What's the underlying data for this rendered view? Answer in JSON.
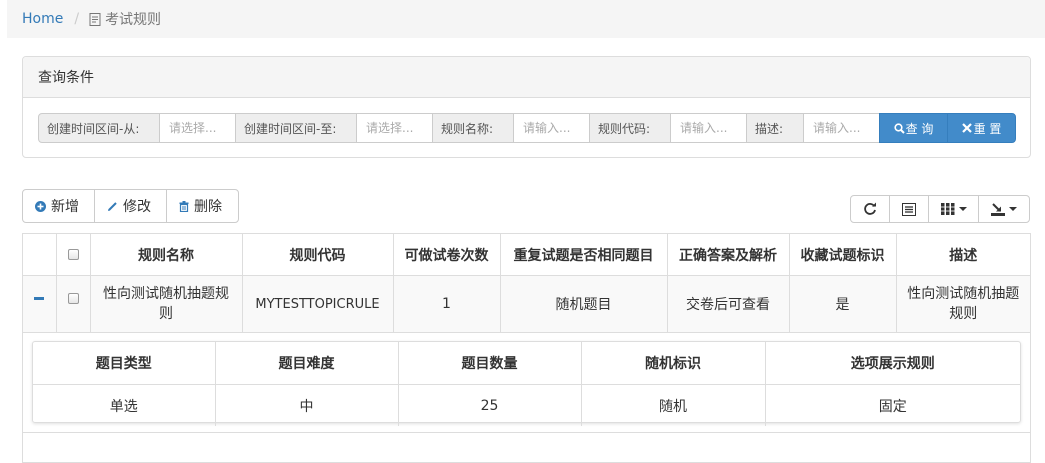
{
  "breadcrumb": {
    "home": "Home",
    "current": "考试规则"
  },
  "search": {
    "panel_title": "查询条件",
    "fields": [
      {
        "label": "创建时间区间-从:",
        "placeholder": "请选择..."
      },
      {
        "label": "创建时间区间-至:",
        "placeholder": "请选择..."
      },
      {
        "label": "规则名称:",
        "placeholder": "请输入..."
      },
      {
        "label": "规则代码:",
        "placeholder": "请输入..."
      },
      {
        "label": "描述:",
        "placeholder": "请输入..."
      }
    ],
    "query_label": "查 询",
    "reset_label": "重 置"
  },
  "toolbar": {
    "add": "新增",
    "edit": "修改",
    "delete": "删除"
  },
  "table": {
    "headers": [
      "规则名称",
      "规则代码",
      "可做试卷次数",
      "重复试题是否相同题目",
      "正确答案及解析",
      "收藏试题标识",
      "描述"
    ],
    "rows": [
      [
        "性向测试随机抽题规则",
        "MYTESTTOPICRULE",
        "1",
        "随机题目",
        "交卷后可查看",
        "是",
        "性向测试随机抽题规则"
      ]
    ]
  },
  "detail": {
    "headers": [
      "题目类型",
      "题目难度",
      "题目数量",
      "随机标识",
      "选项展示规则"
    ],
    "rows": [
      [
        "单选",
        "中",
        "25",
        "随机",
        "固定"
      ]
    ]
  },
  "colors": {
    "primary": "#428bca",
    "link": "#337ab7",
    "border": "#dddddd"
  },
  "icons": {
    "breadcrumb": "document-icon",
    "query": "search-icon",
    "reset": "close-icon",
    "add": "plus-circle-icon",
    "edit": "pencil-icon",
    "delete": "trash-icon",
    "refresh": "refresh-icon",
    "toggle_view": "list-icon",
    "columns": "columns-icon",
    "export": "export-icon",
    "collapse": "minus-icon"
  }
}
